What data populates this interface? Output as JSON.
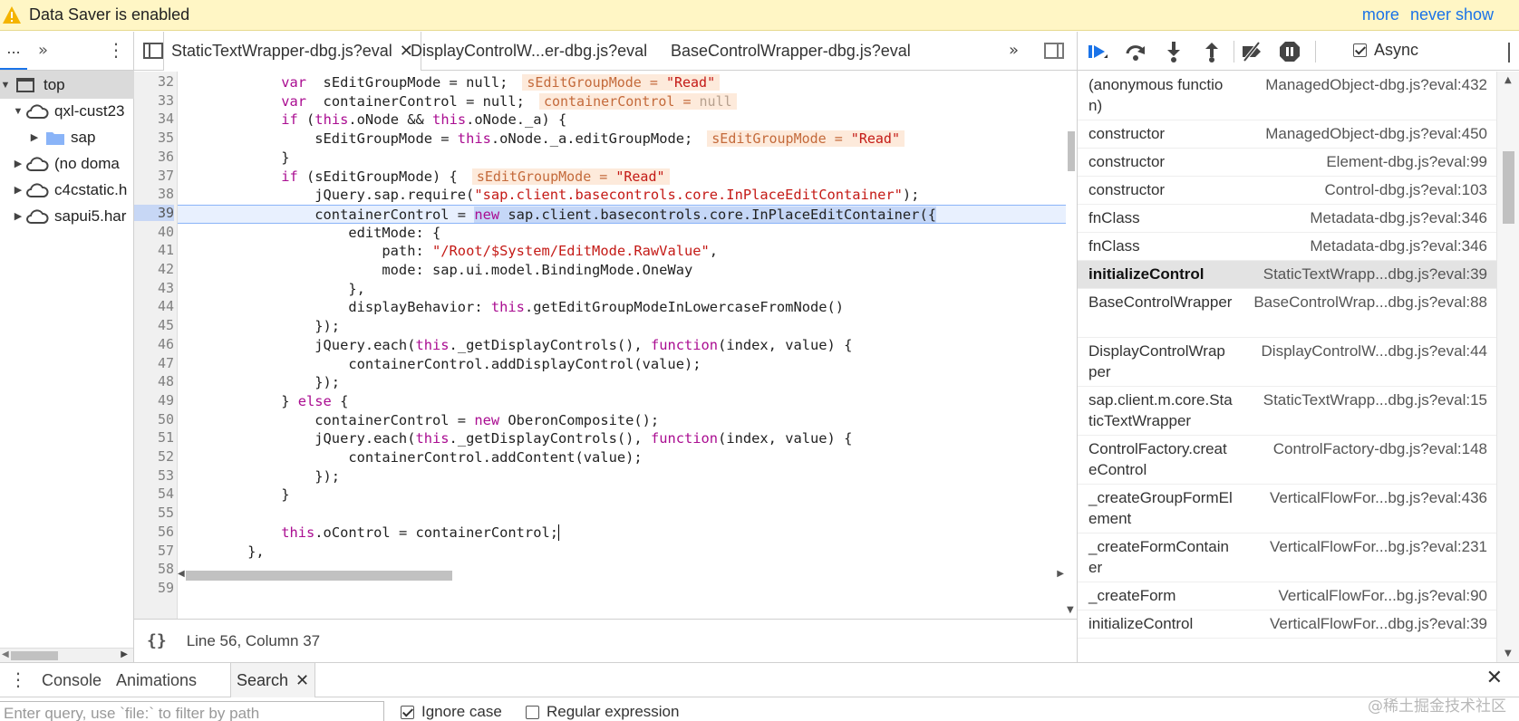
{
  "infobar": {
    "message": "Data Saver is enabled",
    "more": "more",
    "never_show": "never show",
    "bg_color": "#fff6c5"
  },
  "navigator": {
    "more_tab": "...",
    "tree": [
      {
        "label": "top",
        "icon": "frame-icon",
        "selected": true
      },
      {
        "label": "qxl-cust23",
        "icon": "cloud-icon"
      },
      {
        "label": "sap",
        "icon": "folder-icon"
      },
      {
        "label": "(no doma",
        "icon": "cloud-icon"
      },
      {
        "label": "c4cstatic.h",
        "icon": "cloud-icon"
      },
      {
        "label": "sapui5.har",
        "icon": "cloud-icon"
      }
    ]
  },
  "editor": {
    "tabs": [
      {
        "label": "StaticTextWrapper-dbg.js?eval",
        "active": true
      },
      {
        "label": "DisplayControlW...er-dbg.js?eval"
      },
      {
        "label": "BaseControlWrapper-dbg.js?eval"
      }
    ],
    "status": {
      "braces": "{}",
      "position": "Line 56, Column 37"
    },
    "highlight_color": "#c5d7f7",
    "lines": [
      {
        "n": "32",
        "i": "            ",
        "t": [
          [
            "kw",
            "var"
          ],
          [
            "",
            "  sEditGroupMode = null;"
          ]
        ],
        "inline": {
          "name": "sEditGroupMode",
          "value": "\"Read\""
        }
      },
      {
        "n": "33",
        "i": "            ",
        "t": [
          [
            "kw",
            "var"
          ],
          [
            "",
            "  containerControl = null;"
          ]
        ],
        "inline": {
          "name": "containerControl",
          "value": "null",
          "isnull": true
        }
      },
      {
        "n": "34",
        "i": "            ",
        "t": [
          [
            "kw",
            "if"
          ],
          [
            "",
            " ("
          ],
          [
            "kw",
            "this"
          ],
          [
            "",
            ".oNode && "
          ],
          [
            "kw",
            "this"
          ],
          [
            "",
            ".oNode._a) {"
          ]
        ]
      },
      {
        "n": "35",
        "i": "                ",
        "t": [
          [
            "",
            "sEditGroupMode = "
          ],
          [
            "kw",
            "this"
          ],
          [
            "",
            ".oNode._a.editGroupMode;"
          ]
        ],
        "inline": {
          "name": "sEditGroupMode",
          "value": "\"Read\""
        }
      },
      {
        "n": "36",
        "i": "            ",
        "t": [
          [
            "",
            "}"
          ]
        ]
      },
      {
        "n": "37",
        "i": "            ",
        "t": [
          [
            "kw",
            "if"
          ],
          [
            "",
            " (sEditGroupMode) {"
          ]
        ],
        "inline": {
          "name": "sEditGroupMode",
          "value": "\"Read\""
        }
      },
      {
        "n": "38",
        "i": "                ",
        "t": [
          [
            "",
            "jQuery.sap.require("
          ],
          [
            "str",
            "\"sap.client.basecontrols.core.InPlaceEditContainer\""
          ],
          [
            "",
            ");"
          ]
        ]
      },
      {
        "n": "39",
        "i": "                ",
        "t": [
          [
            "",
            "containerControl = "
          ],
          [
            "kwsel",
            "new"
          ],
          [
            "sel",
            " sap.client.basecontrols.core.InPlaceEditContainer({"
          ]
        ],
        "highlight": true
      },
      {
        "n": "40",
        "i": "                    ",
        "t": [
          [
            "",
            "editMode: {"
          ]
        ]
      },
      {
        "n": "41",
        "i": "                        ",
        "t": [
          [
            "",
            "path: "
          ],
          [
            "str",
            "\"/Root/$System/EditMode.RawValue\""
          ],
          [
            "",
            ","
          ]
        ]
      },
      {
        "n": "42",
        "i": "                        ",
        "t": [
          [
            "",
            "mode: sap.ui.model.BindingMode.OneWay"
          ]
        ]
      },
      {
        "n": "43",
        "i": "                    ",
        "t": [
          [
            "",
            "},"
          ]
        ]
      },
      {
        "n": "44",
        "i": "                    ",
        "t": [
          [
            "",
            "displayBehavior: "
          ],
          [
            "kw",
            "this"
          ],
          [
            "",
            ".getEditGroupModeInLowercaseFromNode()"
          ]
        ]
      },
      {
        "n": "45",
        "i": "                ",
        "t": [
          [
            "",
            "});"
          ]
        ]
      },
      {
        "n": "46",
        "i": "                ",
        "t": [
          [
            "",
            "jQuery.each("
          ],
          [
            "kw",
            "this"
          ],
          [
            "",
            "._getDisplayControls(), "
          ],
          [
            "kw",
            "function"
          ],
          [
            "",
            "(index, value) {"
          ]
        ]
      },
      {
        "n": "47",
        "i": "                    ",
        "t": [
          [
            "",
            "containerControl.addDisplayControl(value);"
          ]
        ]
      },
      {
        "n": "48",
        "i": "                ",
        "t": [
          [
            "",
            "});"
          ]
        ]
      },
      {
        "n": "49",
        "i": "            ",
        "t": [
          [
            "",
            "} "
          ],
          [
            "kw",
            "else"
          ],
          [
            "",
            " {"
          ]
        ]
      },
      {
        "n": "50",
        "i": "                ",
        "t": [
          [
            "",
            "containerControl = "
          ],
          [
            "kw",
            "new"
          ],
          [
            "",
            " OberonComposite();"
          ]
        ]
      },
      {
        "n": "51",
        "i": "                ",
        "t": [
          [
            "",
            "jQuery.each("
          ],
          [
            "kw",
            "this"
          ],
          [
            "",
            "._getDisplayControls(), "
          ],
          [
            "kw",
            "function"
          ],
          [
            "",
            "(index, value) {"
          ]
        ]
      },
      {
        "n": "52",
        "i": "                    ",
        "t": [
          [
            "",
            "containerControl.addContent(value);"
          ]
        ]
      },
      {
        "n": "53",
        "i": "                ",
        "t": [
          [
            "",
            "});"
          ]
        ]
      },
      {
        "n": "54",
        "i": "            ",
        "t": [
          [
            "",
            "}"
          ]
        ]
      },
      {
        "n": "55",
        "i": "",
        "t": [
          [
            "",
            ""
          ]
        ]
      },
      {
        "n": "56",
        "i": "            ",
        "t": [
          [
            "kw",
            "this"
          ],
          [
            "",
            ".oControl = containerControl;"
          ]
        ],
        "caret": true
      },
      {
        "n": "57",
        "i": "        ",
        "t": [
          [
            "",
            "},"
          ]
        ]
      },
      {
        "n": "58",
        "i": "",
        "t": [
          [
            "",
            ""
          ]
        ]
      },
      {
        "n": "59",
        "i": "",
        "t": [
          [
            "",
            ""
          ]
        ]
      }
    ]
  },
  "sidebar": {
    "async_label": "Async",
    "frames": [
      {
        "fn": "(anonymous function)",
        "loc": "ManagedObject-dbg.js?eval:432",
        "two": true
      },
      {
        "fn": "constructor",
        "loc": "ManagedObject-dbg.js?eval:450"
      },
      {
        "fn": "constructor",
        "loc": "Element-dbg.js?eval:99"
      },
      {
        "fn": "constructor",
        "loc": "Control-dbg.js?eval:103"
      },
      {
        "fn": "fnClass",
        "loc": "Metadata-dbg.js?eval:346"
      },
      {
        "fn": "fnClass",
        "loc": "Metadata-dbg.js?eval:346"
      },
      {
        "fn": "initializeControl",
        "loc": "StaticTextWrapp...dbg.js?eval:39",
        "selected": true
      },
      {
        "fn": "BaseControlWrapper",
        "loc": "BaseControlWrap...dbg.js?eval:88",
        "two": true
      },
      {
        "fn": "DisplayControlWrapper",
        "loc": "DisplayControlW...dbg.js?eval:44",
        "two": true
      },
      {
        "fn": "sap.client.m.core.StaticTextWrapper",
        "loc": "StaticTextWrapp...dbg.js?eval:15",
        "two": true
      },
      {
        "fn": "ControlFactory.createControl",
        "loc": "ControlFactory-dbg.js?eval:148",
        "two": true
      },
      {
        "fn": "_createGroupFormElement",
        "loc": "VerticalFlowFor...bg.js?eval:436",
        "two": true
      },
      {
        "fn": "_createFormContainer",
        "loc": "VerticalFlowFor...bg.js?eval:231",
        "two": true
      },
      {
        "fn": "_createForm",
        "loc": "VerticalFlowFor...bg.js?eval:90"
      },
      {
        "fn": "initializeControl",
        "loc": "VerticalFlowFor...dbg.js?eval:39"
      }
    ]
  },
  "drawer": {
    "tabs": [
      {
        "label": "Console"
      },
      {
        "label": "Animations"
      },
      {
        "label": "Search",
        "active": true
      }
    ],
    "search_placeholder": "Enter query, use `file:` to filter by path",
    "ignore_case": "Ignore case",
    "regex": "Regular expression",
    "watermark": "@稀土掘金技术社区"
  }
}
